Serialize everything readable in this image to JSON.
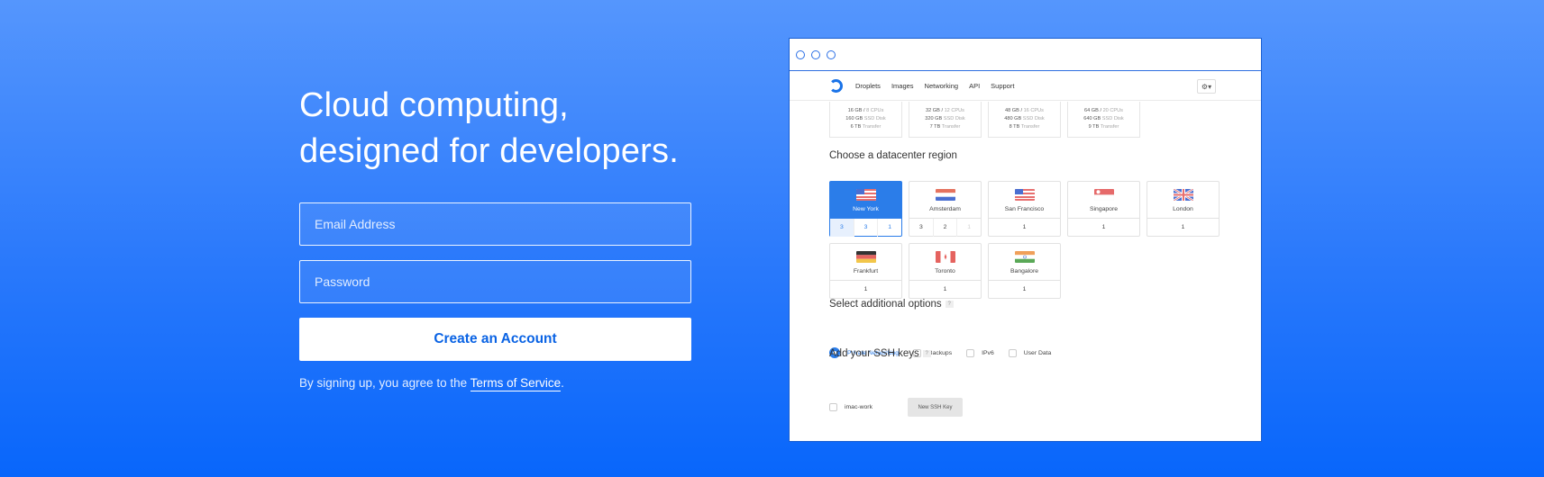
{
  "hero": {
    "headline": "Cloud computing,\ndesigned for developers.",
    "email_placeholder": "Email Address",
    "password_placeholder": "Password",
    "cta_label": "Create an Account",
    "terms_prefix": "By signing up, you agree to the ",
    "terms_link": "Terms of Service",
    "terms_suffix": "."
  },
  "mock": {
    "nav": {
      "links": [
        "Droplets",
        "Images",
        "Networking",
        "API",
        "Support"
      ],
      "settings_icon": "gear-icon"
    },
    "sizes": [
      {
        "ram": "16 GB",
        "cpu": "8 CPUs",
        "disk": "160 GB",
        "disk_label": "SSD Disk",
        "transfer": "6 TB",
        "transfer_label": "Transfer"
      },
      {
        "ram": "32 GB",
        "cpu": "12 CPUs",
        "disk": "320 GB",
        "disk_label": "SSD Disk",
        "transfer": "7 TB",
        "transfer_label": "Transfer"
      },
      {
        "ram": "48 GB",
        "cpu": "16 CPUs",
        "disk": "480 GB",
        "disk_label": "SSD Disk",
        "transfer": "8 TB",
        "transfer_label": "Transfer"
      },
      {
        "ram": "64 GB",
        "cpu": "20 CPUs",
        "disk": "640 GB",
        "disk_label": "SSD Disk",
        "transfer": "9 TB",
        "transfer_label": "Transfer"
      }
    ],
    "region_title": "Choose a datacenter region",
    "regions": [
      {
        "name": "New York",
        "nums": [
          "3",
          "3",
          "1"
        ],
        "selected": true
      },
      {
        "name": "Amsterdam",
        "nums": [
          "3",
          "2",
          "1"
        ],
        "selected": false
      },
      {
        "name": "San Francisco",
        "nums": [
          "1"
        ],
        "selected": false
      },
      {
        "name": "Singapore",
        "nums": [
          "1"
        ],
        "selected": false
      },
      {
        "name": "London",
        "nums": [
          "1"
        ],
        "selected": false
      },
      {
        "name": "Frankfurt",
        "nums": [
          "1"
        ],
        "selected": false
      },
      {
        "name": "Toronto",
        "nums": [
          "1"
        ],
        "selected": false
      },
      {
        "name": "Bangalore",
        "nums": [
          "1"
        ],
        "selected": false
      }
    ],
    "options_title": "Select additional options",
    "options": [
      {
        "label": "Private Networking",
        "checked": true
      },
      {
        "label": "Backups",
        "checked": false
      },
      {
        "label": "IPv6",
        "checked": false
      },
      {
        "label": "User Data",
        "checked": false
      }
    ],
    "ssh_title": "Add your SSH keys",
    "ssh_key": "imac-work",
    "new_key_label": "New SSH Key",
    "help_glyph": "?"
  },
  "colors": {
    "accent": "#2b7de9",
    "bg_top": "#5596fd",
    "bg_bottom": "#0866fb"
  }
}
